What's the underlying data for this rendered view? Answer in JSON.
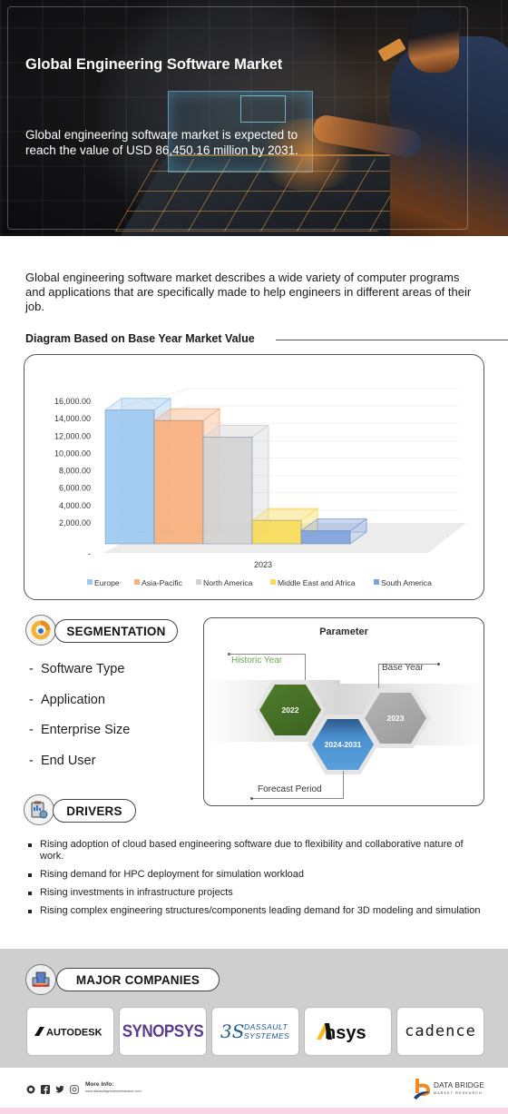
{
  "hero": {
    "title": "Global Engineering Software Market",
    "subtitle": "Global engineering software market is expected to reach the value of USD 86,450.16 million by 2031."
  },
  "intro": "Global engineering software market describes a wide variety of computer programs and applications that are specifically made to help engineers in different areas of their job.",
  "diagram_title": "Diagram Based on Base Year Market Value",
  "chart_data": {
    "type": "bar",
    "style": "3d-clustered",
    "title": "",
    "xlabel": "",
    "ylabel": "",
    "categories": [
      "2023"
    ],
    "series": [
      {
        "name": "Europe",
        "values": [
          15400
        ],
        "color": "#9dc8f0"
      },
      {
        "name": "Asia-Pacific",
        "values": [
          14200
        ],
        "color": "#f8b07e"
      },
      {
        "name": "North America",
        "values": [
          12300
        ],
        "color": "#d2d2d2"
      },
      {
        "name": "Middle East and Africa",
        "values": [
          2700
        ],
        "color": "#f9dc5a"
      },
      {
        "name": "South America",
        "values": [
          1500
        ],
        "color": "#7fa2dc"
      }
    ],
    "ylim": [
      0,
      16000
    ],
    "yticks": [
      "-",
      "2,000.00",
      "4,000.00",
      "6,000.00",
      "8,000.00",
      "10,000.00",
      "12,000.00",
      "14,000.00",
      "16,000.00"
    ],
    "grid": true,
    "legend": "bottom"
  },
  "segmentation": {
    "label": "SEGMENTATION",
    "items": [
      "Software Type",
      "Application",
      "Enterprise Size",
      "End User"
    ]
  },
  "parameter": {
    "title": "Parameter",
    "historic_label": "Historic Year",
    "historic_value": "2022",
    "base_label": "Base Year",
    "base_value": "2023",
    "forecast_label": "Forecast Period",
    "forecast_value": "2024-2031",
    "colors": {
      "historic": "#4f7d2c",
      "base": "#9a9a9a",
      "forecast": "#4a8fd0",
      "historic_text": "#6aa84f"
    }
  },
  "drivers": {
    "label": "DRIVERS",
    "items": [
      "Rising adoption of cloud based engineering software due to flexibility and collaborative nature of work.",
      "Rising demand for HPC deployment for simulation workload",
      "Rising investments in infrastructure projects",
      "Rising complex engineering structures/components leading demand for 3D modeling and simulation"
    ]
  },
  "companies": {
    "label": "MAJOR COMPANIES",
    "logos": [
      {
        "name": "AUTODESK",
        "color": "#111111"
      },
      {
        "name": "SYNOPSYS",
        "color": "#5b3a91"
      },
      {
        "name": "DASSAULT SYSTEMES",
        "color": "#1d5a8f"
      },
      {
        "name": "Ansys",
        "color": "#111111",
        "accent": "#ffb71b"
      },
      {
        "name": "cadence",
        "color": "#1a1a1a",
        "accent": "#e03030"
      }
    ]
  },
  "footer": {
    "more_info_label": "More Info:",
    "website": "www.databridgemarketresearch.com",
    "brand_name": "DATA BRIDGE",
    "brand_tagline": "MARKET RESEARCH",
    "social_icons": [
      "whatsapp-icon",
      "facebook-icon",
      "twitter-icon",
      "instagram-icon"
    ]
  }
}
